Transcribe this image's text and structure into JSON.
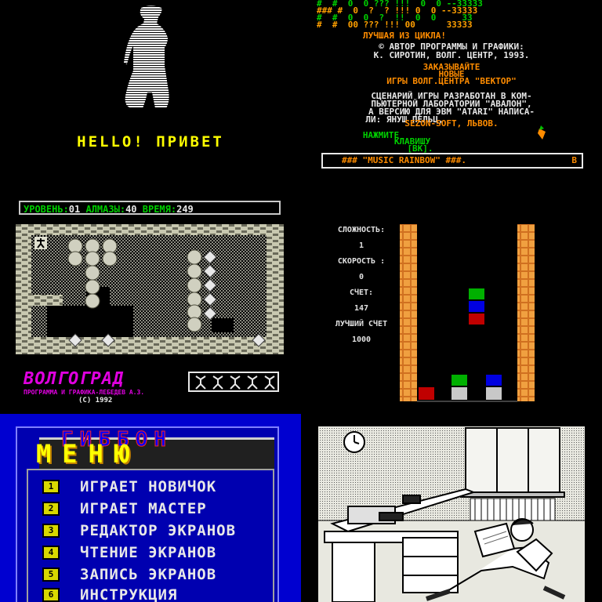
{
  "panel1": {
    "greeting": "HELLO! ПРИВЕТ"
  },
  "panel2": {
    "pattern_lines": [
      "#  #  0  0 ??? !!!  0  0 --33333",
      "### #  0  ?  ? !!! 0  0 --33333",
      "#  #  0  0  ?  !!  0  0     33",
      "#  #  00 ??? !!! 00      33333"
    ],
    "best_of_cycle": "ЛУЧШАЯ ИЗ ЦИКЛА!",
    "author_line1": "© АВТОР ПРОГРАММЫ И ГРАФИКИ:",
    "author_line2": "К. СИРОТИН, ВОЛГ. ЦЕНТР, 1993.",
    "order_line1": "ЗАКАЗЫВАЙТЕ",
    "order_line2": "НОВЫЕ",
    "order_line3": "ИГРЫ ВОЛГ.ЦЕНТРА \"ВЕКТОР\"",
    "scenario_line1": "СЦЕНАРИЙ ИГРЫ РАЗРАБОТАН В КОМ-",
    "scenario_line2": "ПЬЮТЕРНОЙ ЛАБОРАТОРИИ \"АВАЛОН\",",
    "scenario_line3": "А ВЕРСИЮ ДЛЯ ЭВМ \"ATARI\" НАПИСА-",
    "scenario_line4": "ЛИ: ЯНУШ ПЕЛЬЦ,",
    "sezon": "SEZON-SOFT, ЛЬВОВ.",
    "press_line1": "НАЖМИТЕ",
    "press_line2": "КЛАВИШУ",
    "press_line3": "[ВК].",
    "music_bar": "### \"MUSIC RAINBOW\" ###.",
    "music_letter": "B"
  },
  "panel3": {
    "level_label": "УРОВЕНЬ:",
    "level_value": "01",
    "diamonds_label": "АЛМАЗЫ:",
    "diamonds_value": "40",
    "time_label": "ВРЕМЯ:",
    "time_value": "249",
    "city": "ВОЛГОГРАД",
    "credits": "ПРОГРАММА И ГРАФИКА-ЛЕБЕДЕВ А.З.",
    "year": "(C) 1992"
  },
  "panel4": {
    "difficulty_label": "СЛОЖНОСТЬ:",
    "difficulty_value": "1",
    "speed_label": "СКОРОСТЬ :",
    "speed_value": "0",
    "score_label": "СЧЕТ:",
    "score_value": "147",
    "best_label": "ЛУЧШИЙ СЧЕТ",
    "best_value": "1000",
    "colors": {
      "green": "#00b000",
      "blue": "#0000e0",
      "red": "#c00000",
      "grey": "#c8c8c8"
    }
  },
  "panel5": {
    "title_top": "ГИББОН",
    "title_main": "МЕНЮ",
    "items": [
      {
        "num": "1",
        "label": "ИГРАЕТ НОВИЧОК"
      },
      {
        "num": "2",
        "label": "ИГРАЕТ МАСТЕР"
      },
      {
        "num": "3",
        "label": "РЕДАКТОР ЭКРАНОВ"
      },
      {
        "num": "4",
        "label": "ЧТЕНИЕ ЭКРАНОВ"
      },
      {
        "num": "5",
        "label": "ЗАПИСЬ ЭКРАНОВ"
      },
      {
        "num": "6",
        "label": "ИНСТРУКЦИЯ"
      }
    ]
  },
  "panel6": {}
}
